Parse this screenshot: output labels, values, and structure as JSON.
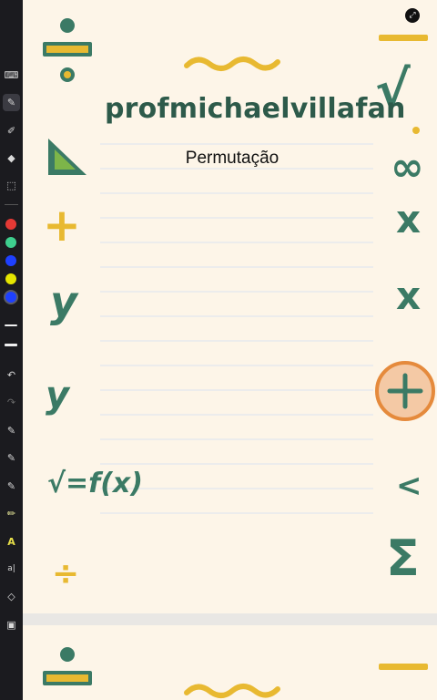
{
  "toolbar": {
    "tools": [
      {
        "name": "keyboard-icon",
        "glyph": "⌨"
      },
      {
        "name": "pen-icon",
        "glyph": "✎",
        "active": true
      },
      {
        "name": "highlighter-icon",
        "glyph": "✐"
      },
      {
        "name": "eraser-icon",
        "glyph": "◆"
      },
      {
        "name": "lasso-select-icon",
        "glyph": "⬚"
      }
    ],
    "colors": [
      "#e53935",
      "#3ecf8e",
      "#1e40ff",
      "#e5e500",
      "#1e40ff"
    ],
    "selected_color_index": 4,
    "actions": [
      {
        "name": "undo-icon",
        "glyph": "↶"
      },
      {
        "name": "redo-icon",
        "glyph": "↷",
        "disabled": true
      },
      {
        "name": "shape-pen-icon",
        "glyph": "✎"
      },
      {
        "name": "shape-tool-icon",
        "glyph": "✎"
      },
      {
        "name": "pen-settings-icon",
        "glyph": "✎"
      },
      {
        "name": "marker-icon",
        "glyph": "✏"
      },
      {
        "name": "text-highlight-icon",
        "glyph": "A"
      },
      {
        "name": "text-box-icon",
        "glyph": "a|"
      },
      {
        "name": "shapes-icon",
        "glyph": "◇"
      },
      {
        "name": "image-icon",
        "glyph": "▣"
      }
    ]
  },
  "page": {
    "title": "profmichaelvillafan",
    "subtitle": "Permutação"
  },
  "decorations": {
    "divide": "÷",
    "plus": "+",
    "y": "y",
    "sqrt_fx": "√=f(x)",
    "sqrt": "√",
    "infinity": "∞",
    "times": "x",
    "less_than": "<",
    "sigma": "Σ",
    "wave": "~~~"
  },
  "corner_button": {
    "glyph": "⤢"
  }
}
